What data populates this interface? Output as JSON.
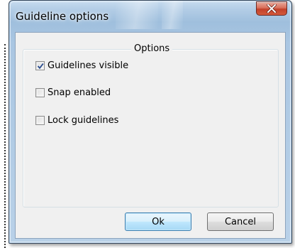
{
  "window": {
    "title": "Guideline options",
    "close_icon": "close-x-icon"
  },
  "group": {
    "legend": "Options"
  },
  "options": [
    {
      "label": "Guidelines visible",
      "checked": true
    },
    {
      "label": "Snap enabled",
      "checked": false
    },
    {
      "label": "Lock guidelines",
      "checked": false
    }
  ],
  "buttons": {
    "ok_label": "Ok",
    "cancel_label": "Cancel"
  },
  "colors": {
    "title_bar": "#b3cde6",
    "close_button": "#c2402a",
    "dialog_background": "#f0f0f0",
    "default_button_border": "#3c7fb1"
  }
}
